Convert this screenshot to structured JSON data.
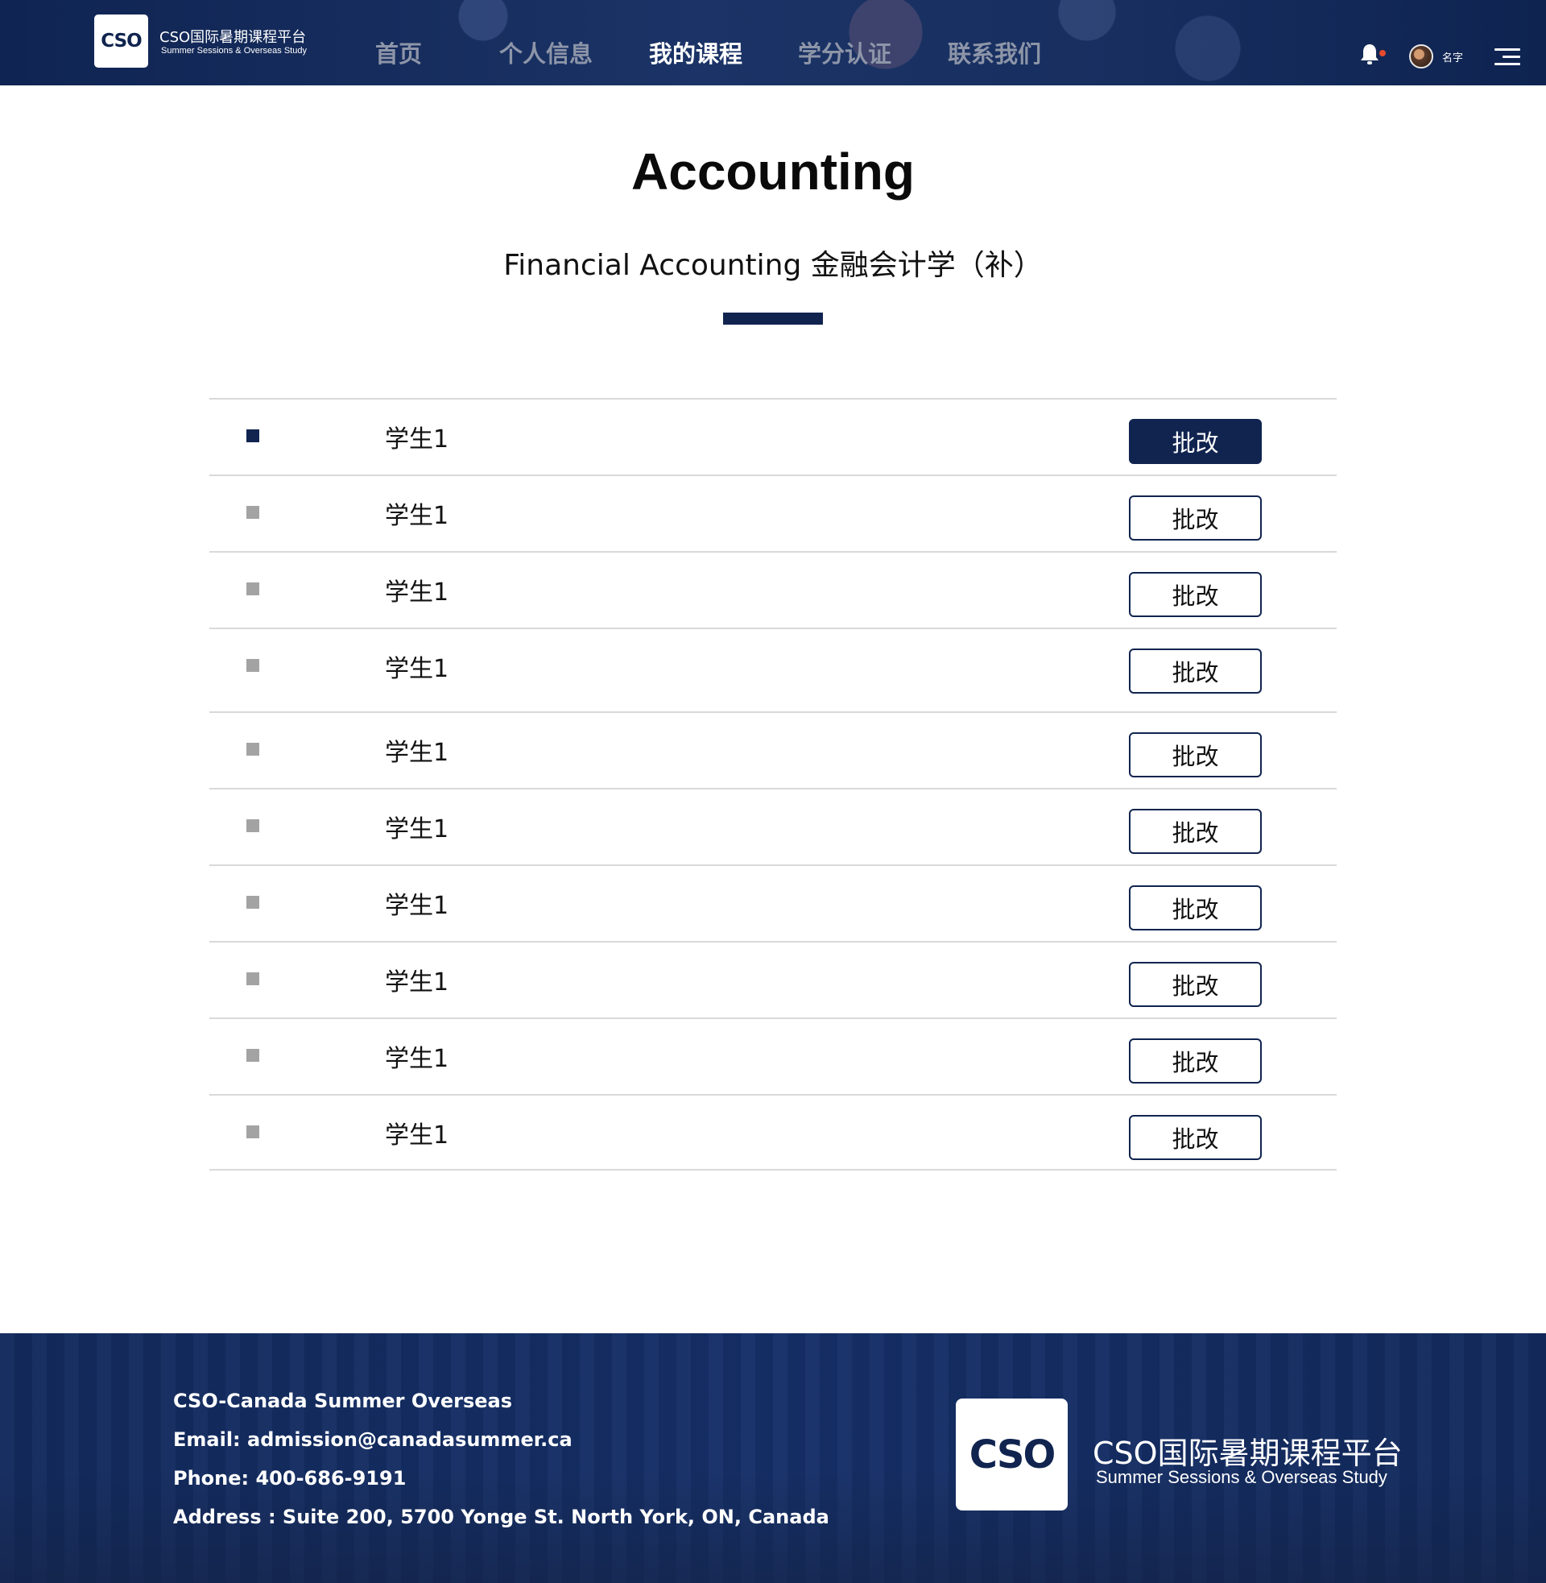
{
  "header": {
    "logo_mark": "CSO",
    "logo_title": "CSO国际暑期课程平台",
    "logo_subtitle": "Summer Sessions & Overseas Study",
    "nav": [
      {
        "label": "首页",
        "active": false
      },
      {
        "label": "个人信息",
        "active": false
      },
      {
        "label": "我的课程",
        "active": true
      },
      {
        "label": "学分认证",
        "active": false
      },
      {
        "label": "联系我们",
        "active": false
      }
    ],
    "user_name": "名字",
    "icons": {
      "notification": "bell-icon",
      "avatar": "avatar",
      "menu": "menu-icon"
    }
  },
  "main": {
    "title": "Accounting",
    "subtitle": "Financial Accounting 金融会计学（补）",
    "students": [
      {
        "name": "学生1",
        "action": "批改",
        "active": true
      },
      {
        "name": "学生1",
        "action": "批改",
        "active": false
      },
      {
        "name": "学生1",
        "action": "批改",
        "active": false
      },
      {
        "name": "学生1",
        "action": "批改",
        "active": false
      },
      {
        "name": "学生1",
        "action": "批改",
        "active": false
      },
      {
        "name": "学生1",
        "action": "批改",
        "active": false
      },
      {
        "name": "学生1",
        "action": "批改",
        "active": false
      },
      {
        "name": "学生1",
        "action": "批改",
        "active": false
      },
      {
        "name": "学生1",
        "action": "批改",
        "active": false
      },
      {
        "name": "学生1",
        "action": "批改",
        "active": false
      }
    ]
  },
  "footer": {
    "company": "CSO-Canada Summer Overseas",
    "email": "Email: admission@canadasummer.ca",
    "phone": "Phone: 400-686-9191",
    "address": "Address : Suite 200, 5700 Yonge St. North York, ON, Canada",
    "logo_mark": "CSO",
    "brand_title": "CSO国际暑期课程平台",
    "brand_subtitle": "Summer Sessions & Overseas Study"
  },
  "colors": {
    "brand_navy": "#10244f",
    "bullet_inactive": "#a3a3a3",
    "notification_dot": "#e64a2e"
  }
}
